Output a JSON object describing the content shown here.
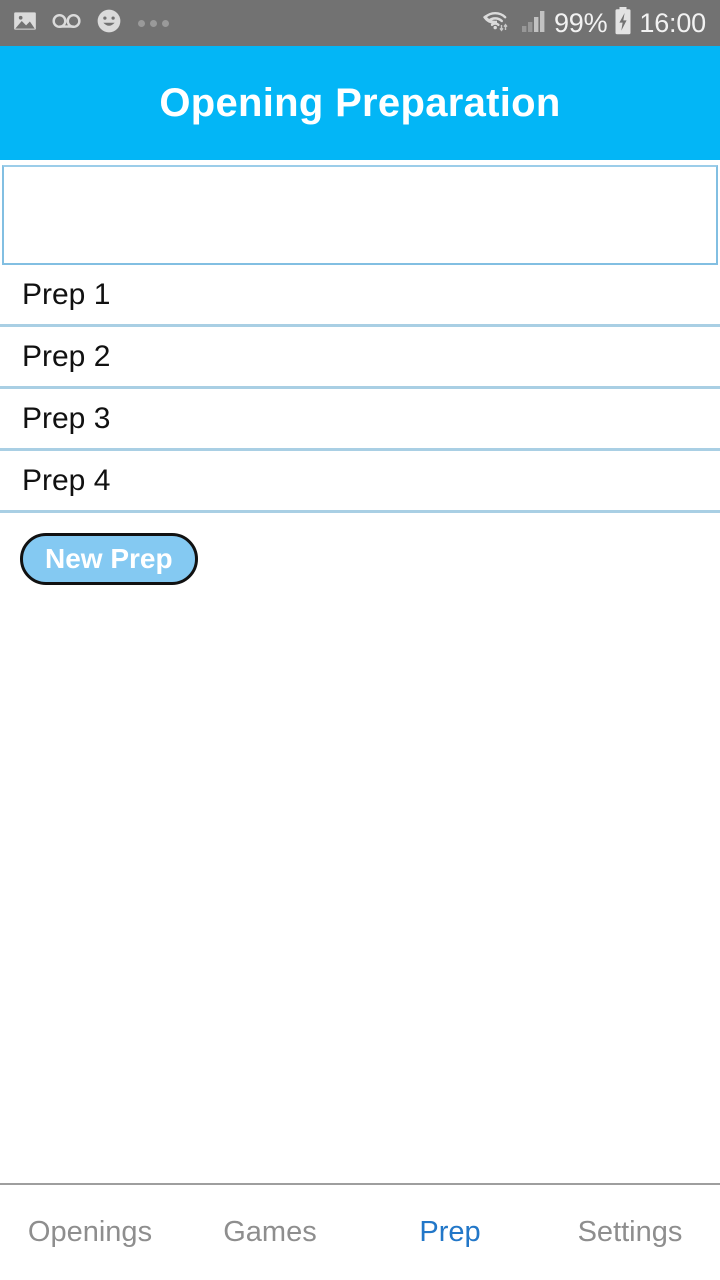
{
  "status_bar": {
    "background": "#727272",
    "left_icons": [
      {
        "name": "image-icon",
        "glyph": "image"
      },
      {
        "name": "voicemail-icon",
        "glyph": "voicemail"
      },
      {
        "name": "smiley-face-icon",
        "glyph": "smiley"
      },
      {
        "name": "more-dots-icon",
        "glyph": "dots"
      }
    ],
    "right_icons": [
      {
        "name": "wifi-icon",
        "glyph": "wifi"
      },
      {
        "name": "signal-bars-icon",
        "glyph": "signal"
      },
      {
        "name": "battery-charging-icon",
        "glyph": "battery"
      }
    ],
    "battery_percent": "99%",
    "clock": "16:00"
  },
  "header": {
    "title": "Opening Preparation",
    "background": "#03b6f6",
    "text_color": "#ffffff"
  },
  "entry": {
    "value": "",
    "placeholder": "",
    "border_color": "#82bfe2"
  },
  "list": {
    "divider_color": "#a9cfe4",
    "items": [
      {
        "label": "Prep 1"
      },
      {
        "label": "Prep 2"
      },
      {
        "label": "Prep 3"
      },
      {
        "label": "Prep 4"
      }
    ]
  },
  "actions": {
    "new_prep_label": "New Prep",
    "new_prep_fill": "#84c9f2",
    "new_prep_border": "#111111",
    "new_prep_text_color": "#ffffff"
  },
  "tab_bar": {
    "active_color": "#2277c8",
    "inactive_color": "#8e8e8e",
    "items": [
      {
        "label": "Openings",
        "active": false
      },
      {
        "label": "Games",
        "active": false
      },
      {
        "label": "Prep",
        "active": true
      },
      {
        "label": "Settings",
        "active": false
      }
    ]
  }
}
